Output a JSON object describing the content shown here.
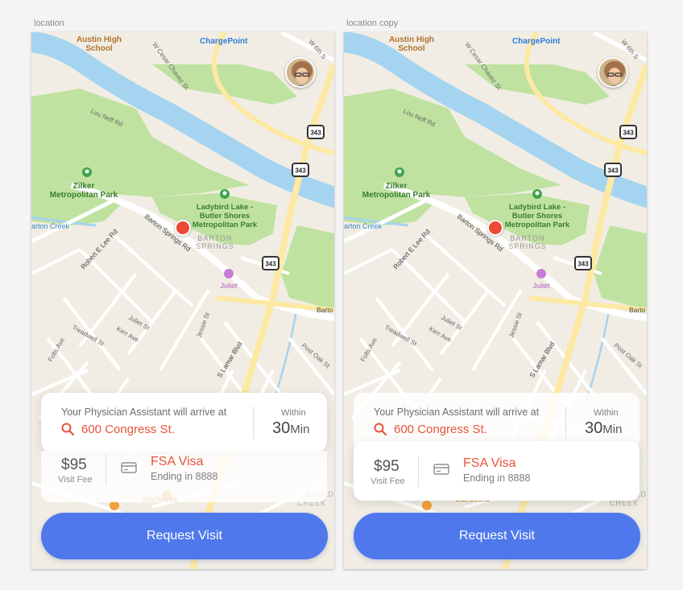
{
  "artboards": [
    {
      "label": "location",
      "physician_label": "Your Physician Assistant will arrive at",
      "address": "600 Congress St.",
      "within_label": "Within",
      "eta_value": "30",
      "eta_unit": "Min",
      "fee_amount": "$95",
      "fee_label": "Visit Fee",
      "payment_name": "FSA Visa",
      "payment_detail": "Ending in 8888",
      "cta_label": "Request Visit"
    },
    {
      "label": "location copy",
      "physician_label": "Your Physician Assistant will arrive at",
      "address": "600 Congress St.",
      "within_label": "Within",
      "eta_value": "30",
      "eta_unit": "Min",
      "fee_amount": "$95",
      "fee_label": "Visit Fee",
      "payment_name": "FSA Visa",
      "payment_detail": "Ending in 8888",
      "cta_label": "Request Visit"
    }
  ],
  "map_labels": {
    "school": [
      "Austin High",
      "School"
    ],
    "chargepoint": "ChargePoint",
    "cesar_chavez": "W Cesar Chavez St",
    "w6th": "W 6th S",
    "lou_neff": "Lou Neff Rd",
    "route_343": "343",
    "zilker": [
      "Zilker",
      "Metropolitan Park"
    ],
    "ladybird": [
      "Ladybird Lake -",
      "Butler Shores",
      "Metropolitan Park"
    ],
    "barton_creek": "arton Creek",
    "barton_springs_rd": "Barton Springs Rd",
    "robert_e_lee": "Robert E Lee Rd",
    "barton_springs_area": [
      "BARTON",
      "SPRINGS"
    ],
    "juliet_poi": "Juliet",
    "barto": "Barto",
    "juliet_st": "Juliet St",
    "treadwell": "Treadwell St",
    "kerr": "Kerr Ave",
    "jessie": "Jessie St",
    "folts": "Folts Ave",
    "s_lamar": "S Lamar Blvd",
    "post_oak": "Post Oak St",
    "starbucks": "Starbucks",
    "creek": "CREEK",
    "bouldin": "BOULD"
  },
  "colors": {
    "accent": "#4f78ec",
    "brand_red": "#e8523c",
    "pin": "#ec4a32",
    "water": "#a4d4f0",
    "park": "#bfe2a0",
    "map_bg": "#f1ede4",
    "highway": "#fde9a3"
  },
  "icons": [
    "search-icon",
    "credit-card-icon",
    "location-pin-icon",
    "user-avatar",
    "park-tree-icon",
    "cocktail-icon",
    "restaurant-icon"
  ]
}
